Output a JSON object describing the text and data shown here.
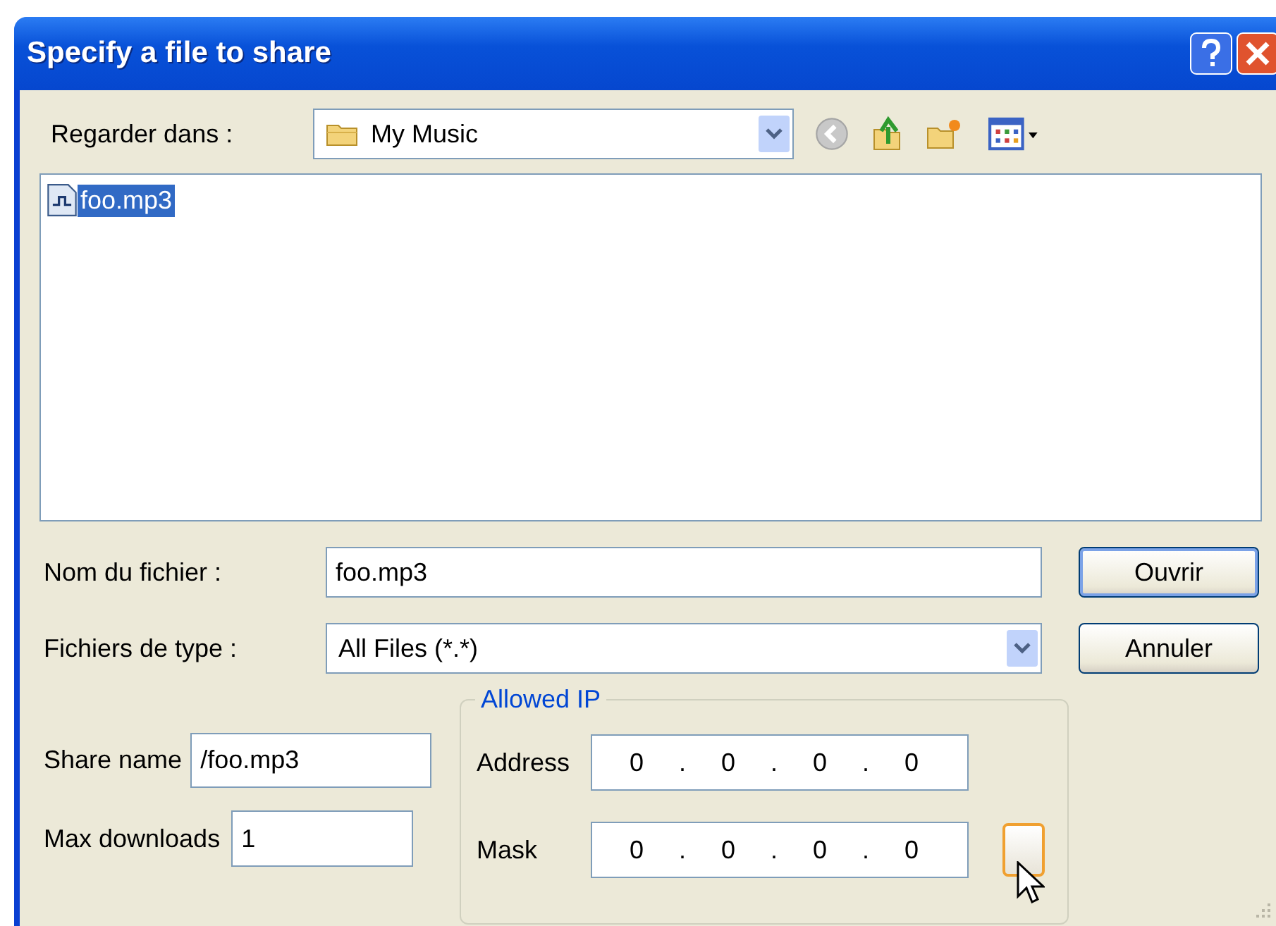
{
  "window": {
    "title": "Specify a file to share"
  },
  "look_in": {
    "label": "Regarder dans :",
    "value": "My Music"
  },
  "files": [
    {
      "name": "foo.mp3",
      "selected": true
    }
  ],
  "file_name": {
    "label": "Nom du fichier :",
    "value": "foo.mp3"
  },
  "file_type": {
    "label": "Fichiers de type :",
    "value": "All Files (*.*)"
  },
  "buttons": [
    {
      "label": "Ouvrir",
      "default": true
    },
    {
      "label": "Annuler",
      "default": false
    }
  ],
  "share_name": {
    "label": "Share name",
    "value": "/foo.mp3"
  },
  "max_downloads": {
    "label": "Max downloads",
    "value": "1"
  },
  "allowed_ip": {
    "legend": "Allowed IP",
    "fields": [
      {
        "label": "Address",
        "octets": [
          "0",
          "0",
          "0",
          "0"
        ],
        "separators": [
          ".",
          ".",
          "."
        ]
      },
      {
        "label": "Mask",
        "octets": [
          "0",
          "0",
          "0",
          "0"
        ],
        "separators": [
          ".",
          ".",
          "."
        ]
      }
    ]
  }
}
